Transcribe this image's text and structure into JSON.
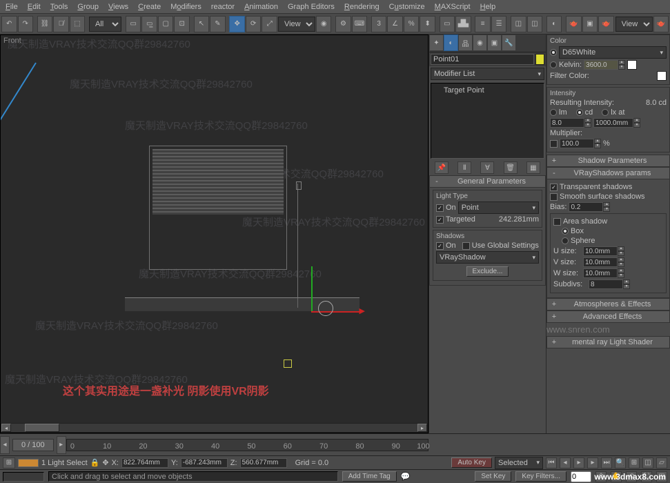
{
  "menu": [
    "File",
    "Edit",
    "Tools",
    "Group",
    "Views",
    "Create",
    "Modifiers",
    "reactor",
    "Animation",
    "Graph Editors",
    "Rendering",
    "Customize",
    "MAXScript",
    "Help"
  ],
  "toolbar": {
    "sel_filter": "All",
    "ref_coord": "View",
    "render_view": "View"
  },
  "viewport": {
    "label": "Front",
    "annotation": "这个其实用途是一盏补光    阴影使用VR阴影"
  },
  "mod": {
    "object_name": "Point01",
    "modifier_list": "Modifier List",
    "stack_item": "Target Point"
  },
  "gen_params": {
    "title": "General Parameters",
    "light_type_grp": "Light Type",
    "on": "On",
    "type": "Point",
    "targeted": "Targeted",
    "target_dist": "242.281mm",
    "shadows_grp": "Shadows",
    "use_global": "Use Global Settings",
    "shadow_type": "VRayShadow",
    "exclude": "Exclude..."
  },
  "color": {
    "title": "Color",
    "preset": "D65White",
    "kelvin": "Kelvin:",
    "kelvin_val": "3600.0",
    "filter": "Filter Color:"
  },
  "intensity": {
    "title": "Intensity",
    "resulting": "Resulting Intensity:",
    "resulting_val": "8.0 cd",
    "lm": "lm",
    "cd": "cd",
    "lxat": "lx at",
    "val1": "8.0",
    "val2": "1000.0mm",
    "multiplier": "Multiplier:",
    "mult_val": "100.0",
    "pct": "%"
  },
  "shadow_params": {
    "title": "Shadow Parameters"
  },
  "vray_shadows": {
    "title": "VRayShadows params",
    "transparent": "Transparent shadows",
    "smooth": "Smooth surface shadows",
    "bias": "Bias:",
    "bias_val": "0.2",
    "area": "Area shadow",
    "box": "Box",
    "sphere": "Sphere",
    "usize": "U size:",
    "vsize": "V size:",
    "wsize": "W size:",
    "size_val": "10.0mm",
    "subdivs": "Subdivs:",
    "subdivs_val": "8"
  },
  "rollups": {
    "atmos": "Atmospheres & Effects",
    "adv": "Advanced Effects",
    "mental": "mental ray Light Shader"
  },
  "timeline": {
    "pos": "0 / 100",
    "ticks": [
      "0",
      "10",
      "20",
      "30",
      "40",
      "50",
      "60",
      "70",
      "80",
      "90",
      "100"
    ]
  },
  "status": {
    "sel": "1 Light Select",
    "x": "822.764mm",
    "y": "-687.243mm",
    "z": "560.677mm",
    "grid": "Grid = 0.0",
    "autokey": "Auto Key",
    "selected": "Selected",
    "setkey": "Set Key",
    "keyfilters": "Key Filters...",
    "addtag": "Add Time Tag"
  },
  "prompt": "Click and drag to select and move objects",
  "watermark": "魔天制造VRAY技术交流QQ群29842760",
  "footer": "www.3dmax8.com",
  "wm_site": "www.snren.com"
}
